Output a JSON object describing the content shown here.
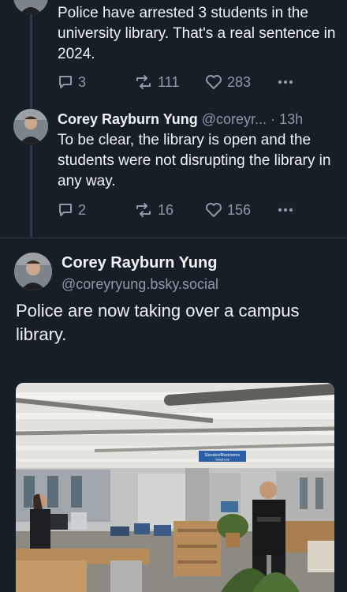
{
  "reply_one": {
    "text": "Police have arrested 3 students in the university library. That's a real sentence in 2024.",
    "comments": "3",
    "reposts": "111",
    "likes": "283"
  },
  "reply_two": {
    "author_name": "Corey Rayburn Yung",
    "author_handle": "@coreyr...",
    "separator": "·",
    "time": "13h",
    "text": "To be clear, the library is open and the students were not disrupting the library in any way.",
    "comments": "2",
    "reposts": "16",
    "likes": "156"
  },
  "main_post": {
    "author_name": "Corey Rayburn Yung",
    "author_handle": "@coreyryung.bsky.social",
    "text": "Police are now taking over a campus library.",
    "image_sign_line1": "Elevator/Restrooms",
    "image_sign_line2": "Telephone"
  },
  "icons": {
    "comment": "comment-bubble-icon",
    "repost": "repost-arrows-icon",
    "like": "heart-icon",
    "more": "more-dots-icon"
  },
  "colors": {
    "background": "#161e27",
    "muted_text": "#8d99a6",
    "thread_line": "#2e3a47"
  }
}
